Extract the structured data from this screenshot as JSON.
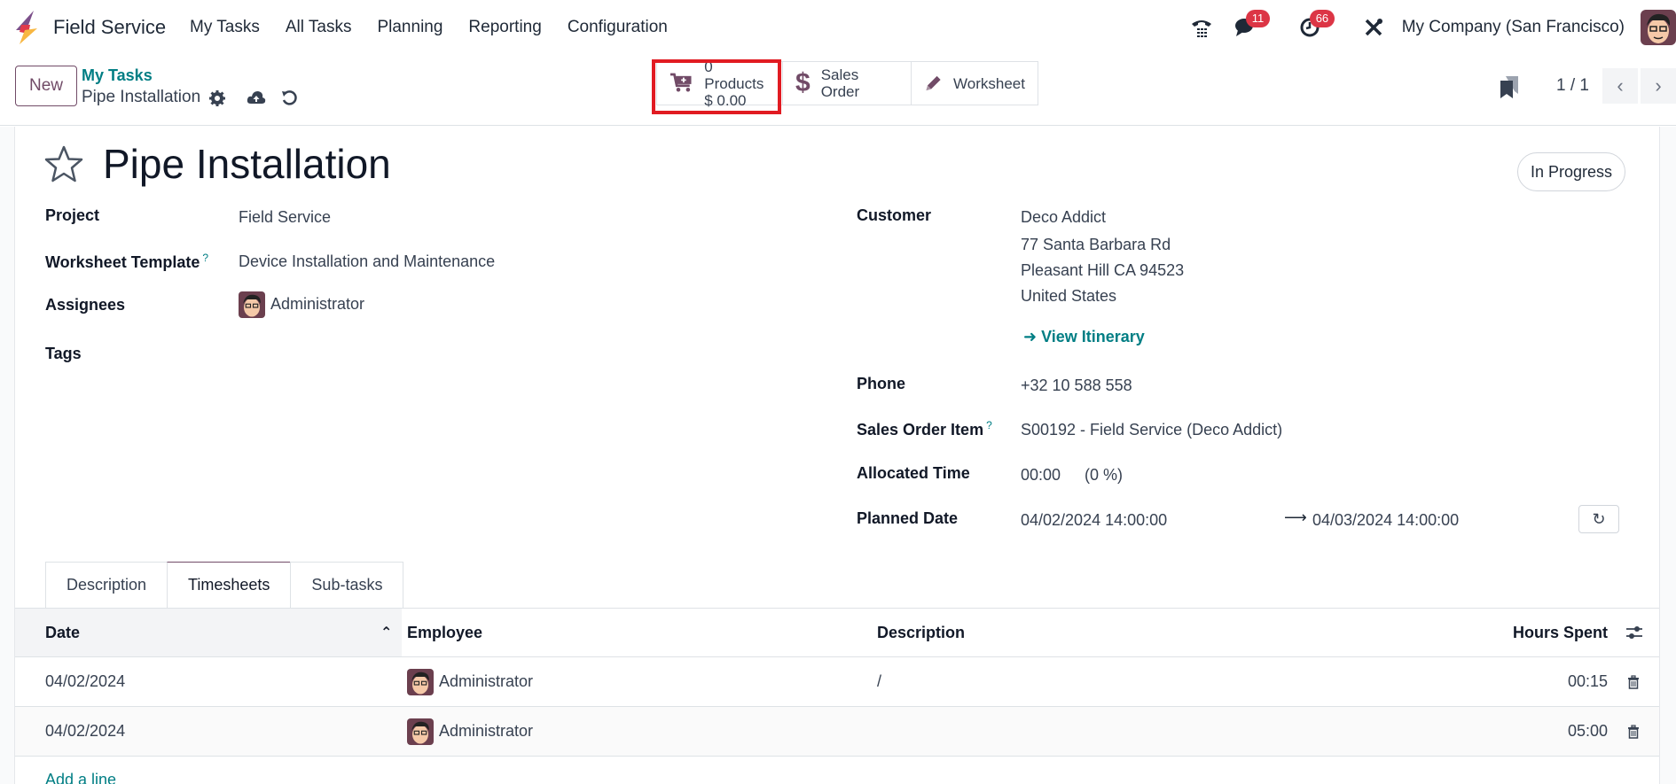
{
  "navbar": {
    "app_name": "Field Service",
    "menu": [
      "My Tasks",
      "All Tasks",
      "Planning",
      "Reporting",
      "Configuration"
    ],
    "messages_count": "11",
    "activities_count": "66",
    "company": "My Company (San Francisco)",
    "icons": [
      "phone-icon",
      "chat-icon",
      "clock-icon",
      "tools-icon"
    ]
  },
  "control": {
    "new_label": "New",
    "breadcrumb_parent": "My Tasks",
    "breadcrumb_current": "Pipe Installation",
    "smart_buttons": {
      "products_count": "0 Products",
      "products_amount": "$ 0.00",
      "sales_order": "Sales Order",
      "worksheet": "Worksheet"
    },
    "pager": "1 / 1",
    "highlight_color": "#e11b22"
  },
  "form": {
    "title": "Pipe Installation",
    "status": "In Progress",
    "left": {
      "project_label": "Project",
      "project": "Field Service",
      "worksheet_template_label": "Worksheet Template",
      "worksheet_template": "Device Installation and Maintenance",
      "assignees_label": "Assignees",
      "assignee": "Administrator",
      "tags_label": "Tags"
    },
    "right": {
      "customer_label": "Customer",
      "customer_name": "Deco Addict",
      "address_line1": "77 Santa Barbara Rd",
      "address_line2": "Pleasant Hill CA 94523",
      "address_country": "United States",
      "view_itinerary": "View Itinerary",
      "phone_label": "Phone",
      "phone": "+32 10 588 558",
      "sales_order_item_label": "Sales Order Item",
      "sales_order_item": "S00192 - Field Service (Deco Addict)",
      "allocated_time_label": "Allocated Time",
      "allocated_time": "00:00",
      "allocated_percent": "(0 %)",
      "planned_date_label": "Planned Date",
      "planned_start": "04/02/2024 14:00:00",
      "planned_end": "04/03/2024 14:00:00"
    },
    "help_marker": "?"
  },
  "tabs": [
    {
      "label": "Description",
      "active": false
    },
    {
      "label": "Timesheets",
      "active": true
    },
    {
      "label": "Sub-tasks",
      "active": false
    }
  ],
  "timesheets": {
    "columns": [
      "Date",
      "Employee",
      "Description",
      "Hours Spent"
    ],
    "rows": [
      {
        "date": "04/02/2024",
        "employee": "Administrator",
        "description": "/",
        "hours": "00:15"
      },
      {
        "date": "04/02/2024",
        "employee": "Administrator",
        "description": "",
        "hours": "05:00"
      }
    ],
    "add_line": "Add a line"
  },
  "colors": {
    "brand": "#714b67",
    "link": "#017e84",
    "badge": "#dc3545"
  }
}
